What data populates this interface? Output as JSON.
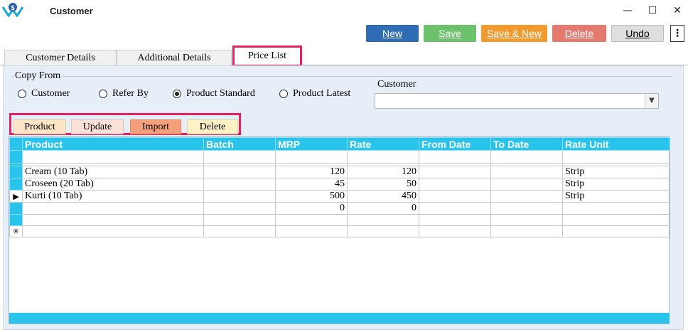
{
  "window": {
    "title": "Customer"
  },
  "toolbar": {
    "new_label": "New",
    "save_label": "Save",
    "save_new_label": "Save & New",
    "delete_label": "Delete",
    "undo_label": "Undo"
  },
  "tabs": [
    {
      "label": "Customer Details"
    },
    {
      "label": "Additional Details"
    },
    {
      "label": "Price List"
    }
  ],
  "copy_from": {
    "legend": "Copy From",
    "options": [
      "Customer",
      "Refer By",
      "Product Standard",
      "Product Latest"
    ],
    "selected": "Product Standard",
    "customer_label": "Customer",
    "customer_value": ""
  },
  "actions": {
    "product_label": "Product",
    "update_label": "Update",
    "import_label": "Import",
    "delete_label": "Delete"
  },
  "grid": {
    "columns": [
      "Product",
      "Batch",
      "MRP",
      "Rate",
      "From Date",
      "To Date",
      "Rate Unit"
    ],
    "rows": [
      {
        "product": "Cream (10 Tab)",
        "batch": "",
        "mrp": "120",
        "rate": "120",
        "from": "",
        "to": "",
        "unit": "Strip"
      },
      {
        "product": "Croseen (20 Tab)",
        "batch": "",
        "mrp": "45",
        "rate": "50",
        "from": "",
        "to": "",
        "unit": "Strip"
      },
      {
        "product": "Kurti (10 Tab)",
        "batch": "",
        "mrp": "500",
        "rate": "450",
        "from": "",
        "to": "",
        "unit": "Strip"
      },
      {
        "product": "",
        "batch": "",
        "mrp": "0",
        "rate": "0",
        "from": "",
        "to": "",
        "unit": ""
      },
      {
        "product": "",
        "batch": "",
        "mrp": "",
        "rate": "",
        "from": "",
        "to": "",
        "unit": ""
      },
      {
        "product": "",
        "batch": "",
        "mrp": "",
        "rate": "",
        "from": "",
        "to": "",
        "unit": ""
      }
    ]
  },
  "colors": {
    "header_bg": "#29c4ec",
    "highlight": "#e8205e",
    "new_btn": "#2e6db6",
    "save_btn": "#6cc26a",
    "save_new_btn": "#f29a2e",
    "delete_btn": "#e47a6e"
  }
}
